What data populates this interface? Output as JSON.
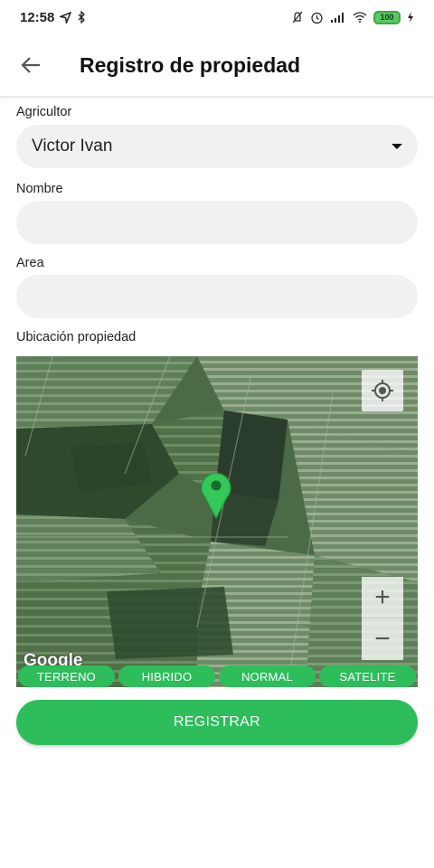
{
  "status_bar": {
    "time": "12:58",
    "battery": "100"
  },
  "app_bar": {
    "title": "Registro de propiedad"
  },
  "form": {
    "farmer": {
      "label": "Agricultor",
      "value": "Victor Ivan"
    },
    "name": {
      "label": "Nombre",
      "value": ""
    },
    "area": {
      "label": "Area",
      "value": ""
    },
    "location": {
      "label": "Ubicación propiedad"
    }
  },
  "map": {
    "attribution": "Google",
    "zoom_in": "+",
    "zoom_out": "−",
    "map_types": [
      "TERRENO",
      "HIBRIDO",
      "NORMAL",
      "SATELITE"
    ]
  },
  "actions": {
    "register_label": "REGISTRAR"
  },
  "colors": {
    "accent": "#2dbd5b",
    "field_bg": "#f1f1f1",
    "marker": "#34c759"
  }
}
